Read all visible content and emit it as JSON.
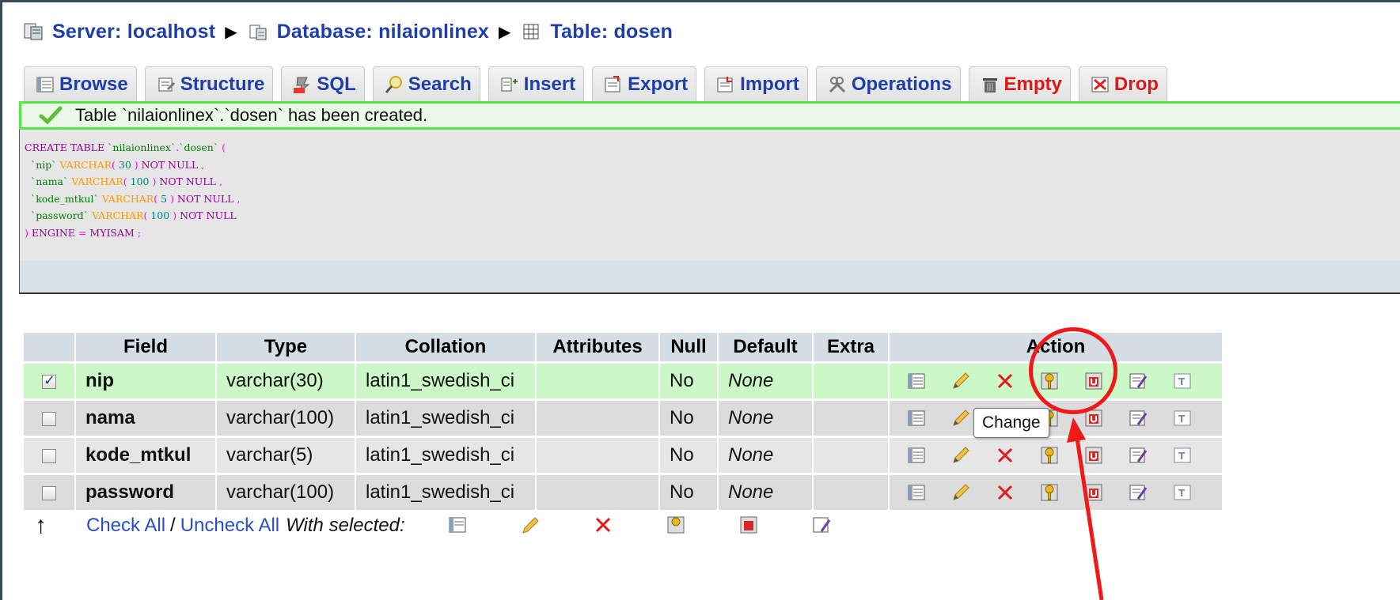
{
  "breadcrumb": {
    "server": "Server: localhost",
    "database": "Database: nilaionlinex",
    "table": "Table: dosen"
  },
  "tabs": [
    {
      "label": "Browse",
      "icon": "browse-icon"
    },
    {
      "label": "Structure",
      "icon": "structure-icon"
    },
    {
      "label": "SQL",
      "icon": "sql-icon"
    },
    {
      "label": "Search",
      "icon": "search-icon"
    },
    {
      "label": "Insert",
      "icon": "insert-icon"
    },
    {
      "label": "Export",
      "icon": "export-icon"
    },
    {
      "label": "Import",
      "icon": "import-icon"
    },
    {
      "label": "Operations",
      "icon": "operations-icon"
    },
    {
      "label": "Empty",
      "icon": "empty-icon"
    },
    {
      "label": "Drop",
      "icon": "drop-icon"
    }
  ],
  "notice": {
    "message": "Table `nilaionlinex`.`dosen` has been created."
  },
  "sql": {
    "line1": {
      "kw1": "CREATE TABLE",
      "id1": "`nilaionlinex`",
      "dot": ".",
      "id2": "`dosen`",
      "paren": "("
    },
    "line2": {
      "col": "`nip`",
      "type": "VARCHAR",
      "open": "(",
      "num": "30",
      "close": ")",
      "kw": "NOT NULL",
      "comma": ","
    },
    "line3": {
      "col": "`nama`",
      "type": "VARCHAR",
      "open": "(",
      "num": "100",
      "close": ")",
      "kw": "NOT NULL",
      "comma": ","
    },
    "line4": {
      "col": "`kode_mtkul`",
      "type": "VARCHAR",
      "open": "(",
      "num": "5",
      "close": ")",
      "kw": "NOT NULL",
      "comma": ","
    },
    "line5": {
      "col": "`password`",
      "type": "VARCHAR",
      "open": "(",
      "num": "100",
      "close": ")",
      "kw": "NOT NULL"
    },
    "line6": {
      "close": ")",
      "kw": "ENGINE",
      "eq": "=",
      "engine": "MYISAM",
      "semi": ";"
    }
  },
  "table": {
    "headers": [
      "Field",
      "Type",
      "Collation",
      "Attributes",
      "Null",
      "Default",
      "Extra",
      "Action"
    ],
    "rows": [
      {
        "field": "nip",
        "type": "varchar(30)",
        "collation": "latin1_swedish_ci",
        "attributes": "",
        "null": "No",
        "default": "None",
        "extra": "",
        "checked": true
      },
      {
        "field": "nama",
        "type": "varchar(100)",
        "collation": "latin1_swedish_ci",
        "attributes": "",
        "null": "No",
        "default": "None",
        "extra": "",
        "checked": false
      },
      {
        "field": "kode_mtkul",
        "type": "varchar(5)",
        "collation": "latin1_swedish_ci",
        "attributes": "",
        "null": "No",
        "default": "None",
        "extra": "",
        "checked": false
      },
      {
        "field": "password",
        "type": "varchar(100)",
        "collation": "latin1_swedish_ci",
        "attributes": "",
        "null": "No",
        "default": "None",
        "extra": "",
        "checked": false
      }
    ],
    "action_icons": [
      "browse-distinct-icon",
      "edit-pencil-icon",
      "delete-x-icon",
      "primary-key-icon",
      "unique-icon",
      "index-icon",
      "fulltext-icon"
    ]
  },
  "footer": {
    "check_all": "Check All",
    "separator": "/",
    "uncheck_all": "Uncheck All",
    "with_selected": "With selected:"
  },
  "tooltip": {
    "text": "Change"
  },
  "colors": {
    "link": "#1f3fa8",
    "danger": "#d91a1a",
    "success_border": "#59e44b",
    "annotation": "#f01818",
    "selected_row": "#ccf7c7",
    "header_bg": "#d4dce4"
  }
}
